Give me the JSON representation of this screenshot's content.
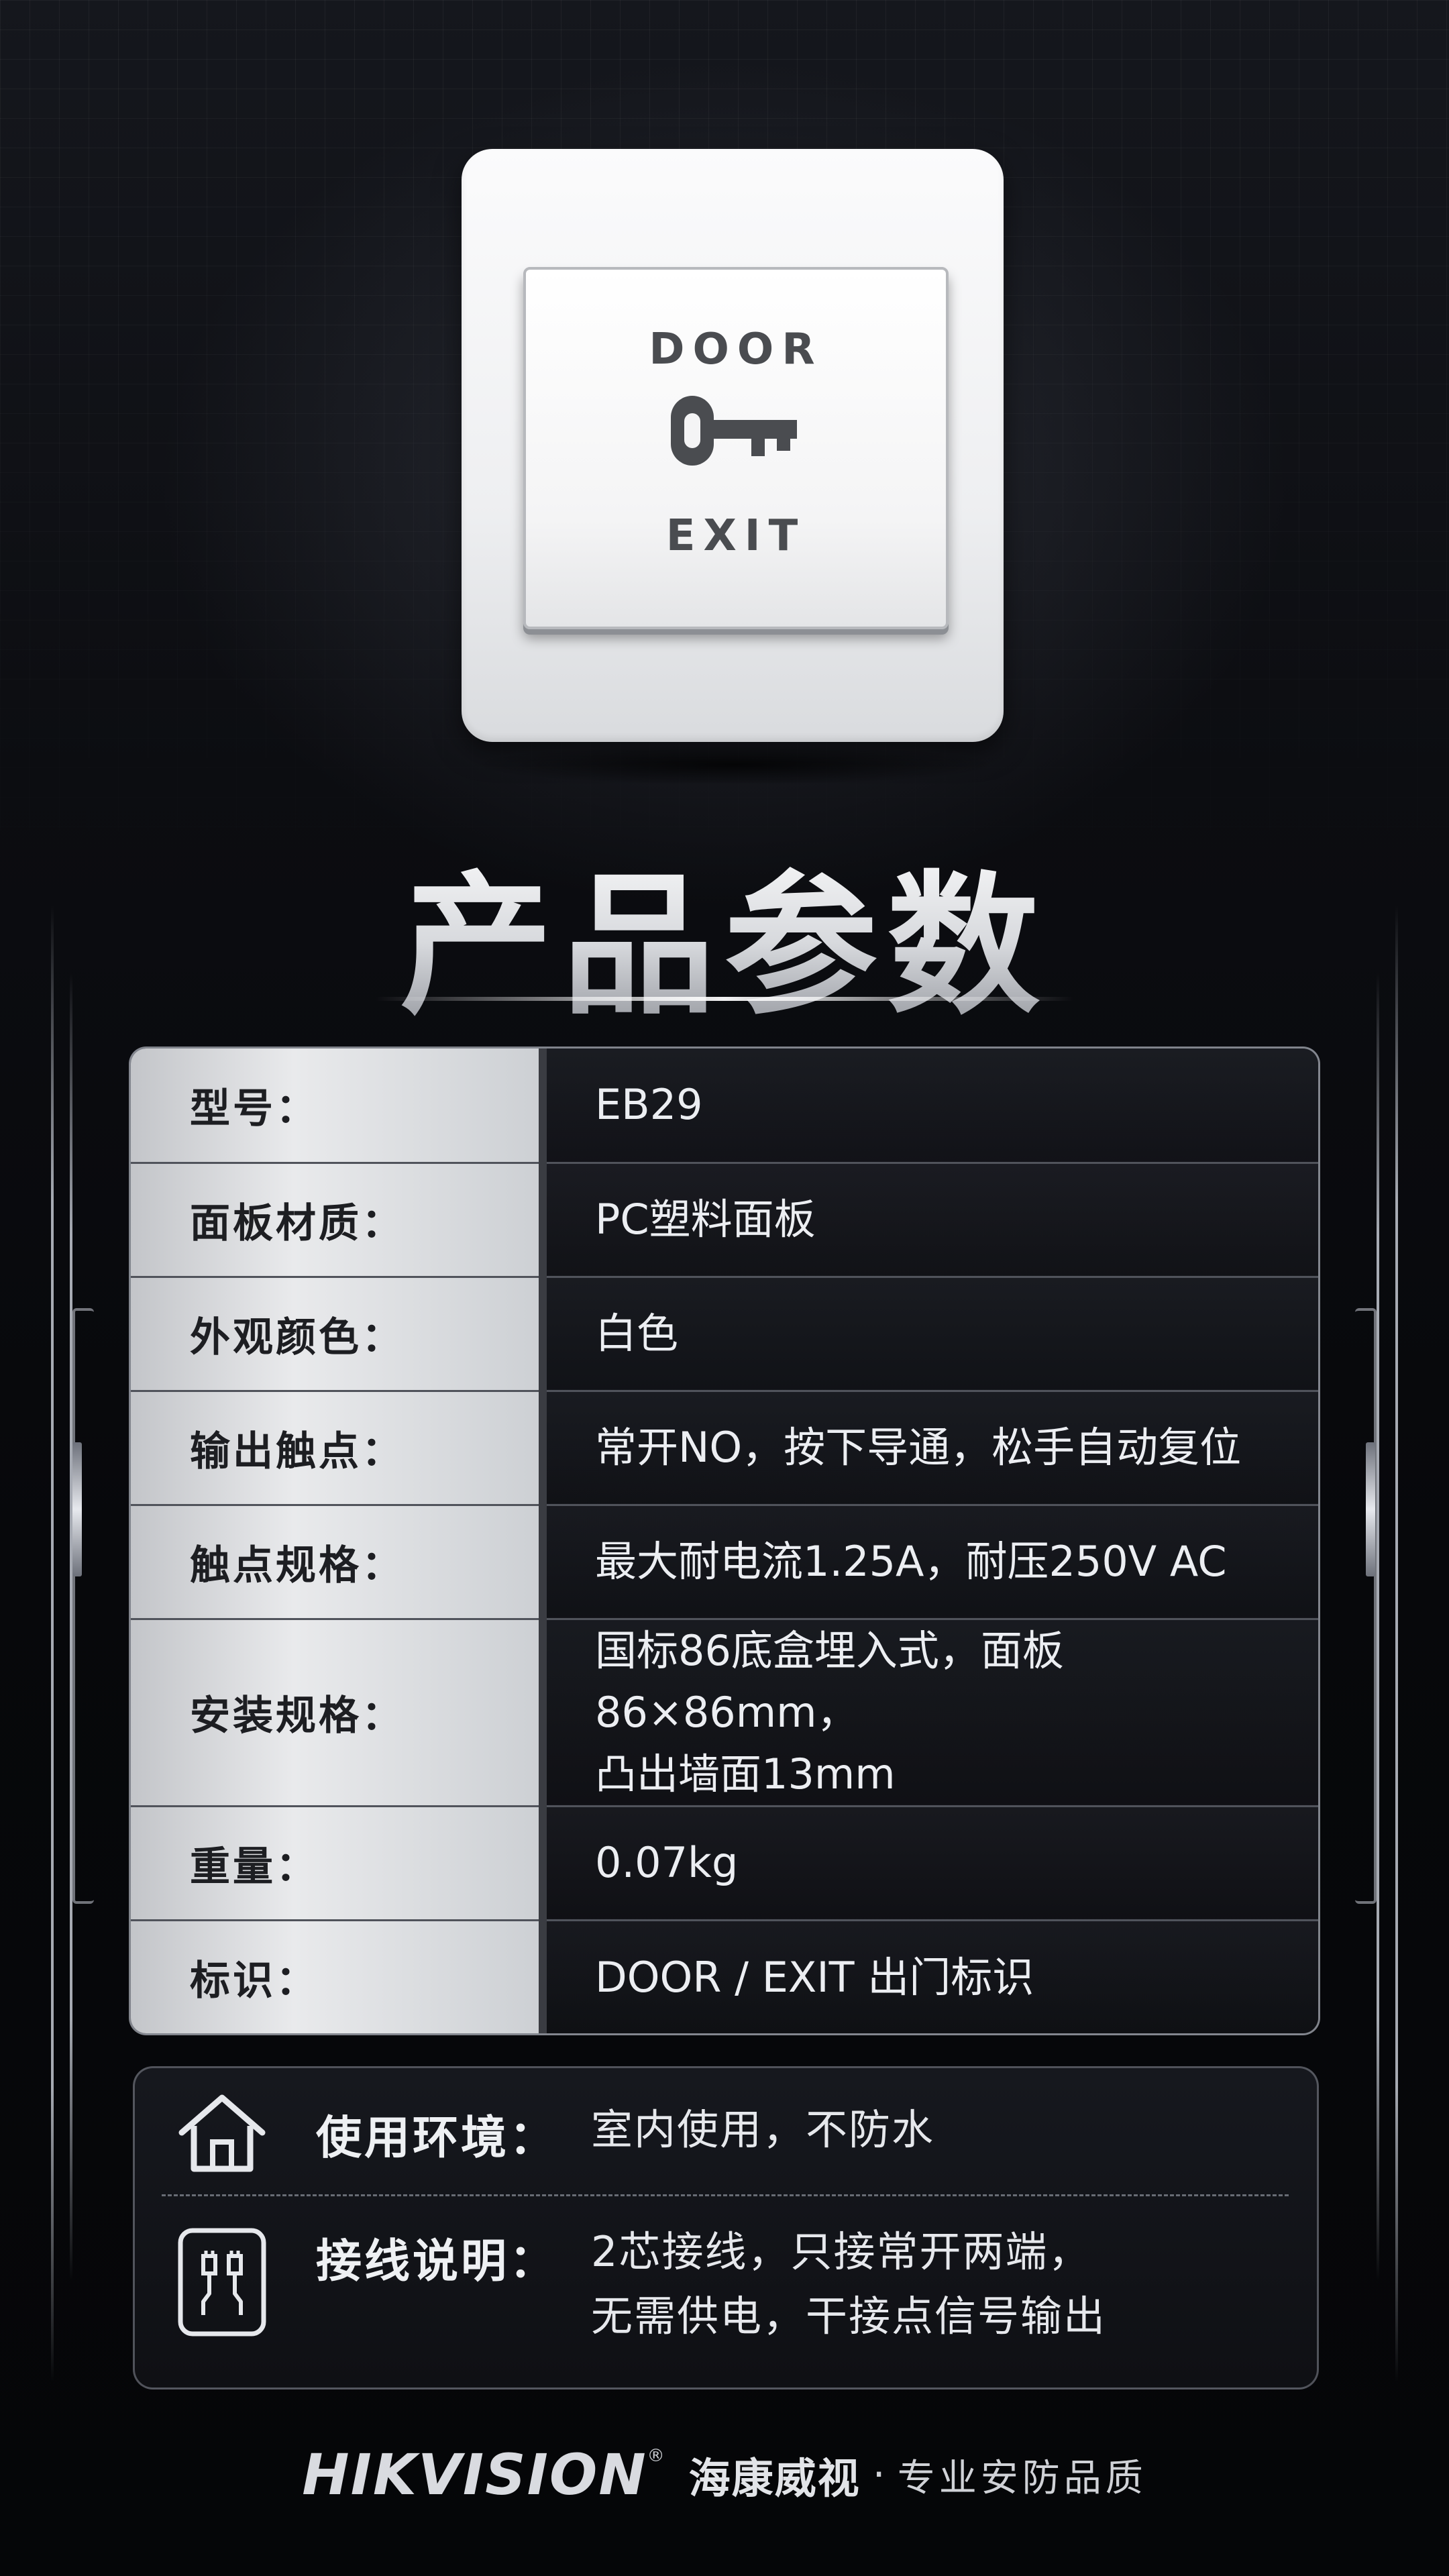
{
  "product": {
    "switch_top_text": "DOOR",
    "switch_bottom_text": "EXIT",
    "switch_icon": "key-icon"
  },
  "title": "产品参数",
  "specs": [
    {
      "label": "型号：",
      "value": "EB29"
    },
    {
      "label": "面板材质：",
      "value": "PC塑料面板"
    },
    {
      "label": "外观颜色：",
      "value": "白色"
    },
    {
      "label": "输出触点：",
      "value": "常开NO，按下导通，松手自动复位"
    },
    {
      "label": "触点规格：",
      "value": "最大耐电流1.25A，耐压250V AC"
    },
    {
      "label": "安装规格：",
      "value_lines": [
        "国标86底盒埋入式，面板86×86mm，",
        "凸出墙面13mm"
      ]
    },
    {
      "label": "重量：",
      "value": "0.07kg"
    },
    {
      "label": "标识：",
      "value": "DOOR / EXIT 出门标识"
    }
  ],
  "info": {
    "environment": {
      "icon": "house-icon",
      "label": "使用环境：",
      "value": "室内使用，不防水"
    },
    "wiring": {
      "icon": "wire-connector-icon",
      "label": "接线说明：",
      "value_lines": [
        "2芯接线，只接常开两端，",
        "无需供电，干接点信号输出"
      ]
    }
  },
  "footer": {
    "brand_en": "HIKVISION",
    "brand_reg": "®",
    "brand_cn": "海康威视",
    "separator": "·",
    "slogan": "专业安防品质"
  },
  "colors": {
    "background": "#07080b",
    "label_cell": "#e9eaec",
    "accent_line": "#ffffff"
  }
}
